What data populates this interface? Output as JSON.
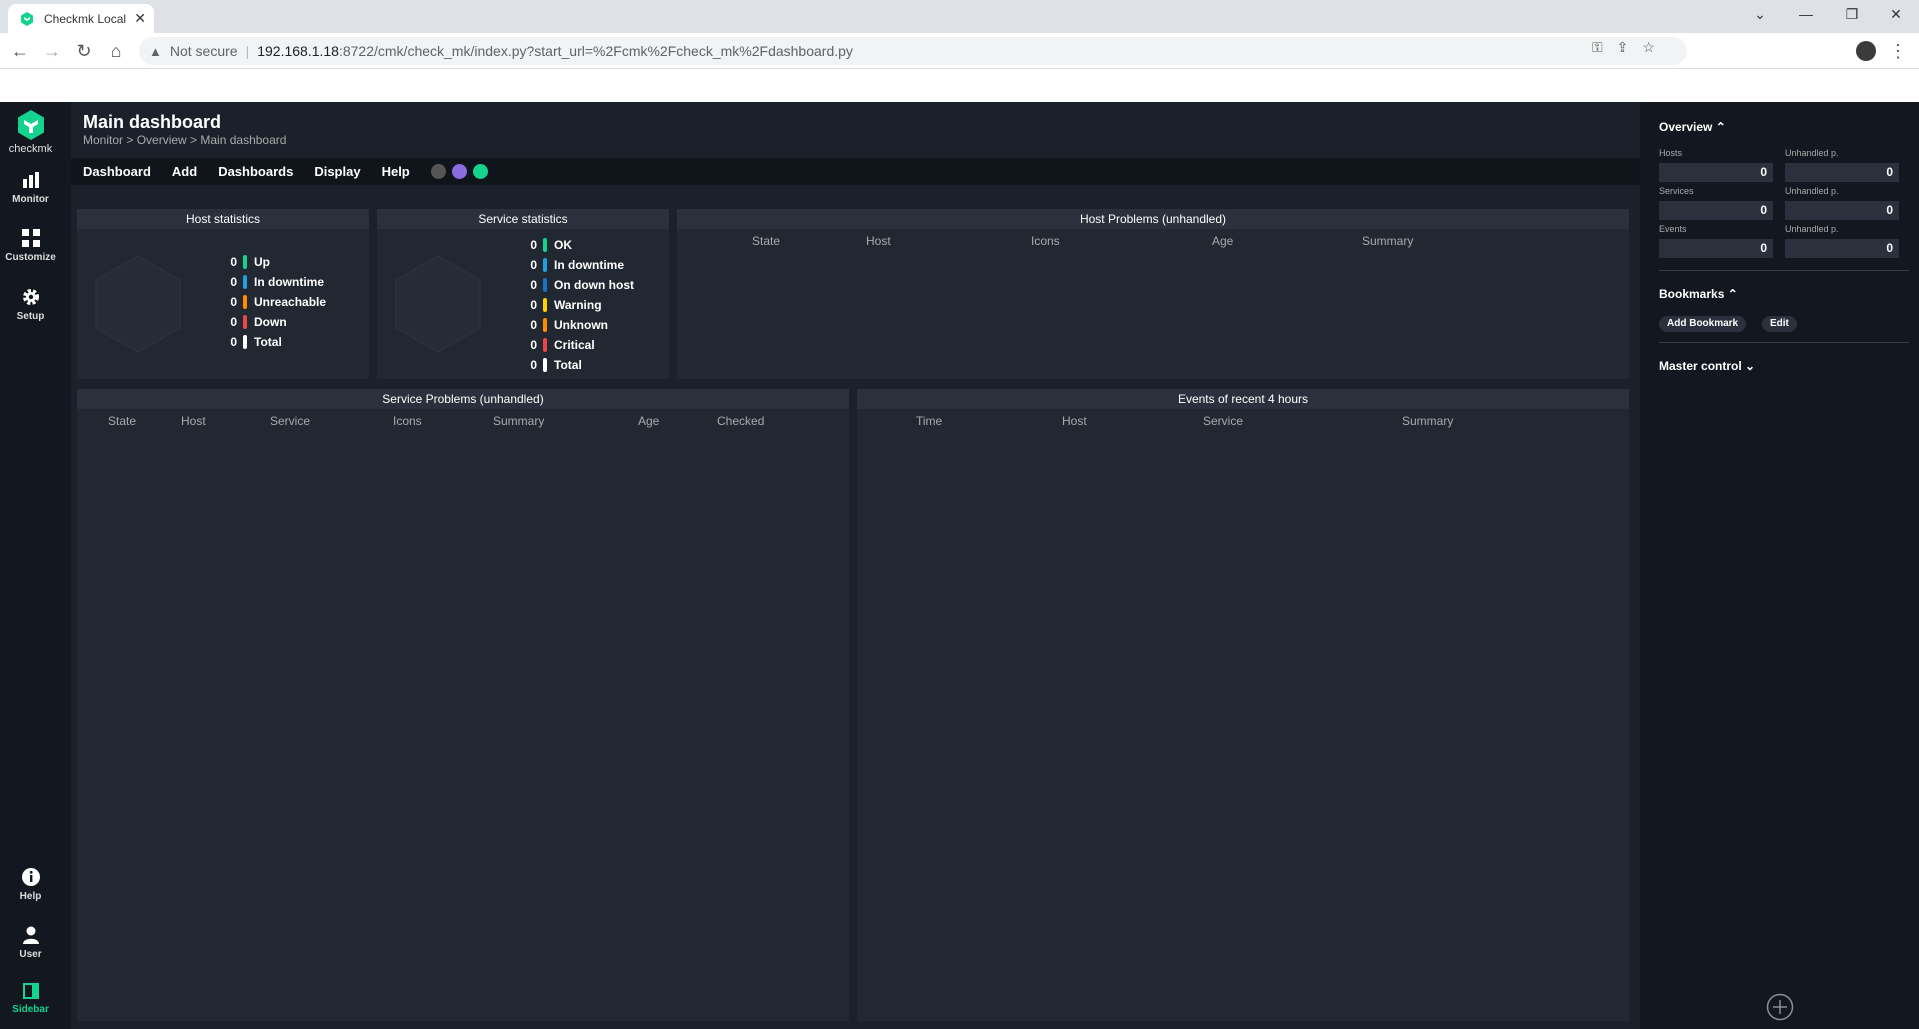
{
  "browser": {
    "tab_title": "Checkmk Local",
    "security": "Not secure",
    "url_host": "192.168.1.18",
    "url_path": ":8722/cmk/check_mk/index.py?start_url=%2Fcmk%2Fcheck_mk%2Fdashboard.py"
  },
  "nav": {
    "logo_text": "checkmk",
    "items": [
      {
        "label": "Monitor",
        "icon": "bar-chart-icon"
      },
      {
        "label": "Customize",
        "icon": "grid-icon"
      },
      {
        "label": "Setup",
        "icon": "gear-icon"
      },
      {
        "label": "Help",
        "icon": "info-icon"
      },
      {
        "label": "User",
        "icon": "user-icon"
      },
      {
        "label": "Sidebar",
        "icon": "sidebar-icon"
      }
    ]
  },
  "page": {
    "title": "Main dashboard",
    "breadcrumb": "Monitor > Overview > Main dashboard",
    "menu": [
      "Dashboard",
      "Add",
      "Dashboards",
      "Display",
      "Help"
    ]
  },
  "colors": {
    "accent": "#13d38e",
    "ok": "#13d38e",
    "downtime": "#1ea1e0",
    "down_host": "#1a72c8",
    "warning": "#ffd000",
    "unreachable": "#ff8c00",
    "unknown": "#ff8c00",
    "critical": "#ee4545",
    "total": "#ffffff"
  },
  "host_stats": {
    "title": "Host statistics",
    "rows": [
      {
        "value": "0",
        "label": "Up",
        "color": "#13d38e"
      },
      {
        "value": "0",
        "label": "In downtime",
        "color": "#1ea1e0"
      },
      {
        "value": "0",
        "label": "Unreachable",
        "color": "#ff8c00"
      },
      {
        "value": "0",
        "label": "Down",
        "color": "#ee4545"
      },
      {
        "value": "0",
        "label": "Total",
        "color": "#ffffff"
      }
    ]
  },
  "service_stats": {
    "title": "Service statistics",
    "rows": [
      {
        "value": "0",
        "label": "OK",
        "color": "#13d38e"
      },
      {
        "value": "0",
        "label": "In downtime",
        "color": "#1ea1e0"
      },
      {
        "value": "0",
        "label": "On down host",
        "color": "#1a72c8"
      },
      {
        "value": "0",
        "label": "Warning",
        "color": "#ffd000"
      },
      {
        "value": "0",
        "label": "Unknown",
        "color": "#ff8c00"
      },
      {
        "value": "0",
        "label": "Critical",
        "color": "#ee4545"
      },
      {
        "value": "0",
        "label": "Total",
        "color": "#ffffff"
      }
    ]
  },
  "host_problems": {
    "title": "Host Problems (unhandled)",
    "columns": [
      "State",
      "Host",
      "Icons",
      "Age",
      "Summary"
    ]
  },
  "service_problems": {
    "title": "Service Problems (unhandled)",
    "columns": [
      "State",
      "Host",
      "Service",
      "Icons",
      "Summary",
      "Age",
      "Checked"
    ]
  },
  "events": {
    "title": "Events of recent 4 hours",
    "columns": [
      "Time",
      "Host",
      "Service",
      "Summary"
    ]
  },
  "sidebar": {
    "overview": {
      "title": "Overview",
      "rows": [
        {
          "label": "Hosts",
          "value": "0",
          "unhandled_label": "Unhandled p.",
          "unhandled_value": "0"
        },
        {
          "label": "Services",
          "value": "0",
          "unhandled_label": "Unhandled p.",
          "unhandled_value": "0"
        },
        {
          "label": "Events",
          "value": "0",
          "unhandled_label": "Unhandled p.",
          "unhandled_value": "0"
        }
      ]
    },
    "bookmarks": {
      "title": "Bookmarks",
      "add": "Add Bookmark",
      "edit": "Edit"
    },
    "master_control": {
      "title": "Master control"
    }
  }
}
